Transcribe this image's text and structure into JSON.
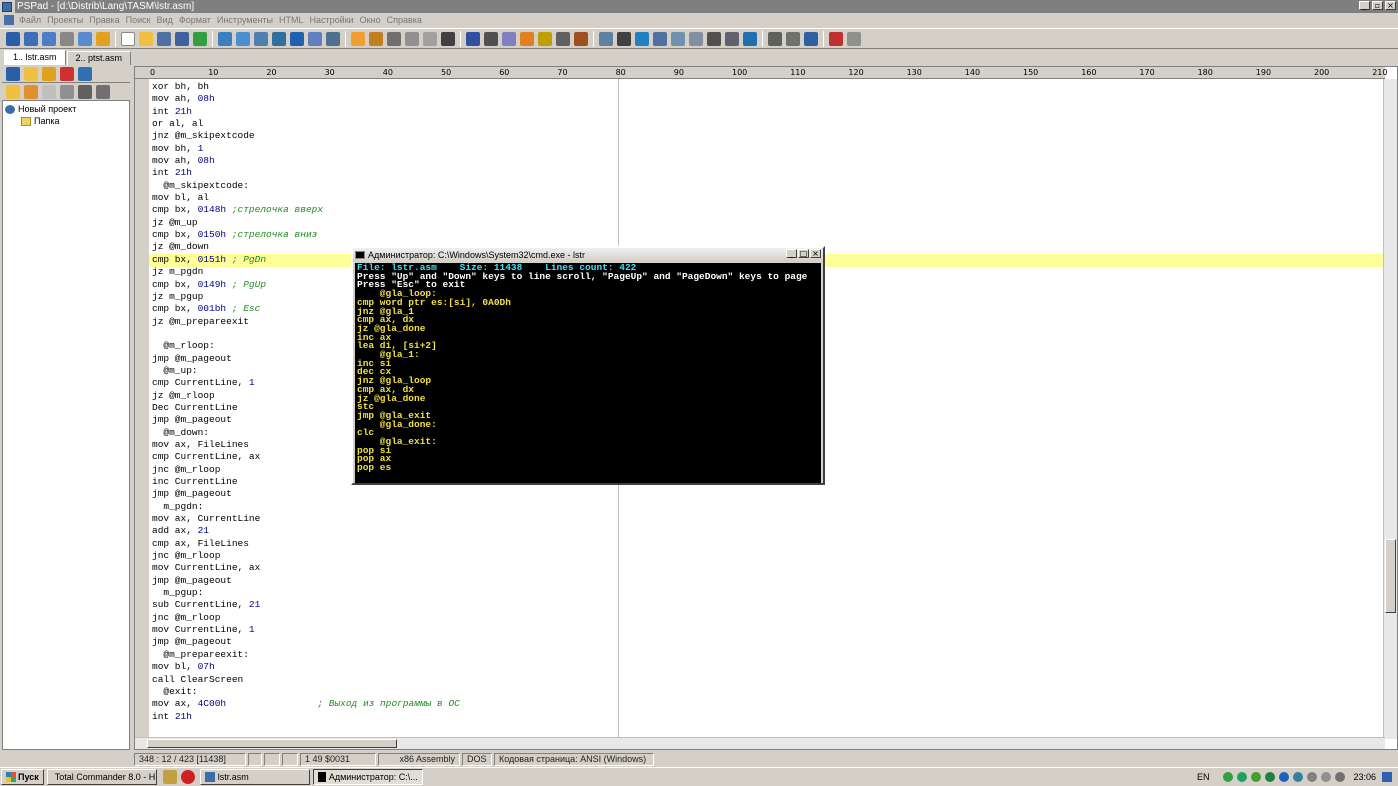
{
  "window": {
    "title": "PSPad - [d:\\Distrib\\Lang\\TASM\\lstr.asm]"
  },
  "menu": [
    "Файл",
    "Проекты",
    "Правка",
    "Поиск",
    "Вид",
    "Формат",
    "Инструменты",
    "HTML",
    "Настройки",
    "Окно",
    "Справка"
  ],
  "tabs": [
    {
      "label": "1.. lstr.asm"
    },
    {
      "label": "2.. ptst.asm"
    }
  ],
  "project_tree": {
    "root": "Новый проект",
    "child": "Папка"
  },
  "ruler": [
    "0",
    "10",
    "20",
    "30",
    "40",
    "50",
    "60",
    "70",
    "80",
    "90",
    "100",
    "110",
    "120",
    "130",
    "140",
    "150",
    "160",
    "170",
    "180",
    "190",
    "200",
    "210"
  ],
  "code": [
    {
      "t": "xor bh, bh"
    },
    {
      "t": "mov ah, ",
      "n": "08h"
    },
    {
      "t": "int ",
      "n": "21h"
    },
    {
      "t": "or al, al"
    },
    {
      "t": "jnz @m_skipextcode"
    },
    {
      "t": "mov bh, ",
      "n": "1"
    },
    {
      "t": "mov ah, ",
      "n": "08h"
    },
    {
      "t": "int ",
      "n": "21h"
    },
    {
      "t": "  @m_skipextcode:"
    },
    {
      "t": "mov bl, al"
    },
    {
      "t": "cmp bx, ",
      "n": "0148h",
      "c": " ;стрелочка вверх"
    },
    {
      "t": "jz @m_up"
    },
    {
      "t": "cmp bx, ",
      "n": "0150h",
      "c": " ;стрелочка вниз"
    },
    {
      "t": "jz @m_down"
    },
    {
      "t": "cmp bx, ",
      "n": "0151h",
      "c": " ; PgDn",
      "hl": true
    },
    {
      "t": "jz m_pgdn"
    },
    {
      "t": "cmp bx, ",
      "n": "0149h",
      "c": " ; PgUp"
    },
    {
      "t": "jz m_pgup"
    },
    {
      "t": "cmp bx, ",
      "n": "001bh",
      "c": " ; Esc"
    },
    {
      "t": "jz @m_prepareexit"
    },
    {
      "t": ""
    },
    {
      "t": "  @m_rloop:"
    },
    {
      "t": "jmp @m_pageout"
    },
    {
      "t": "  @m_up:"
    },
    {
      "t": "cmp CurrentLine, ",
      "n": "1"
    },
    {
      "t": "jz @m_rloop"
    },
    {
      "t": "Dec CurrentLine"
    },
    {
      "t": "jmp @m_pageout"
    },
    {
      "t": "  @m_down:"
    },
    {
      "t": "mov ax, FileLines"
    },
    {
      "t": "cmp CurrentLine, ax"
    },
    {
      "t": "jnc @m_rloop"
    },
    {
      "t": "inc CurrentLine"
    },
    {
      "t": "jmp @m_pageout"
    },
    {
      "t": "  m_pgdn:"
    },
    {
      "t": "mov ax, CurrentLine"
    },
    {
      "t": "add ax, ",
      "n": "21"
    },
    {
      "t": "cmp ax, FileLines"
    },
    {
      "t": "jnc @m_rloop"
    },
    {
      "t": "mov CurrentLine, ax"
    },
    {
      "t": "jmp @m_pageout"
    },
    {
      "t": "  m_pgup:"
    },
    {
      "t": "sub CurrentLine, ",
      "n": "21"
    },
    {
      "t": "jnc @m_rloop"
    },
    {
      "t": "mov CurrentLine, ",
      "n": "1"
    },
    {
      "t": "jmp @m_pageout"
    },
    {
      "t": "  @m_prepareexit:"
    },
    {
      "t": "mov bl, ",
      "n": "07h"
    },
    {
      "t": "call ClearScreen"
    },
    {
      "t": "  @exit:"
    },
    {
      "t": "mov ax, ",
      "n": "4C00h",
      "c": "                ; Выход из программы в ОС"
    },
    {
      "t": "int ",
      "n": "21h"
    }
  ],
  "cmd": {
    "title": "Администратор: C:\\Windows\\System32\\cmd.exe - lstr",
    "header": "File: lstr.asm    Size: 11438    Lines count: 422",
    "help1": "Press \"Up\" and \"Down\" keys to line scroll, \"PageUp\" and \"PageDown\" keys to page",
    "help2": "Press \"Esc\" to exit",
    "lines": [
      "    @gla_loop:",
      "cmp word ptr es:[si], 0A0Dh",
      "jnz @gla_1",
      "cmp ax, dx",
      "jz @gla_done",
      "inc ax",
      "lea di, [si+2]",
      "    @gla_1:",
      "inc si",
      "dec cx",
      "jnz @gla_loop",
      "cmp ax, dx",
      "jz @gla_done",
      "stc",
      "jmp @gla_exit",
      "    @gla_done:",
      "clc",
      "    @gla_exit:",
      "pop si",
      "pop ax",
      "pop es"
    ]
  },
  "status": {
    "position": "348 : 12 / 423  [11438]",
    "col": "1  49  $0031",
    "syntax": "x86 Assembly",
    "format": "DOS",
    "encoding": "Кодовая страница: ANSI (Windows)"
  },
  "taskbar": {
    "start": "Пуск",
    "tasks": [
      {
        "label": "Total Commander 8.0 - H..."
      },
      {
        "label": "lstr.asm"
      },
      {
        "label": "Администратор: C:\\..."
      }
    ],
    "lang": "EN",
    "clock": "23:06"
  }
}
